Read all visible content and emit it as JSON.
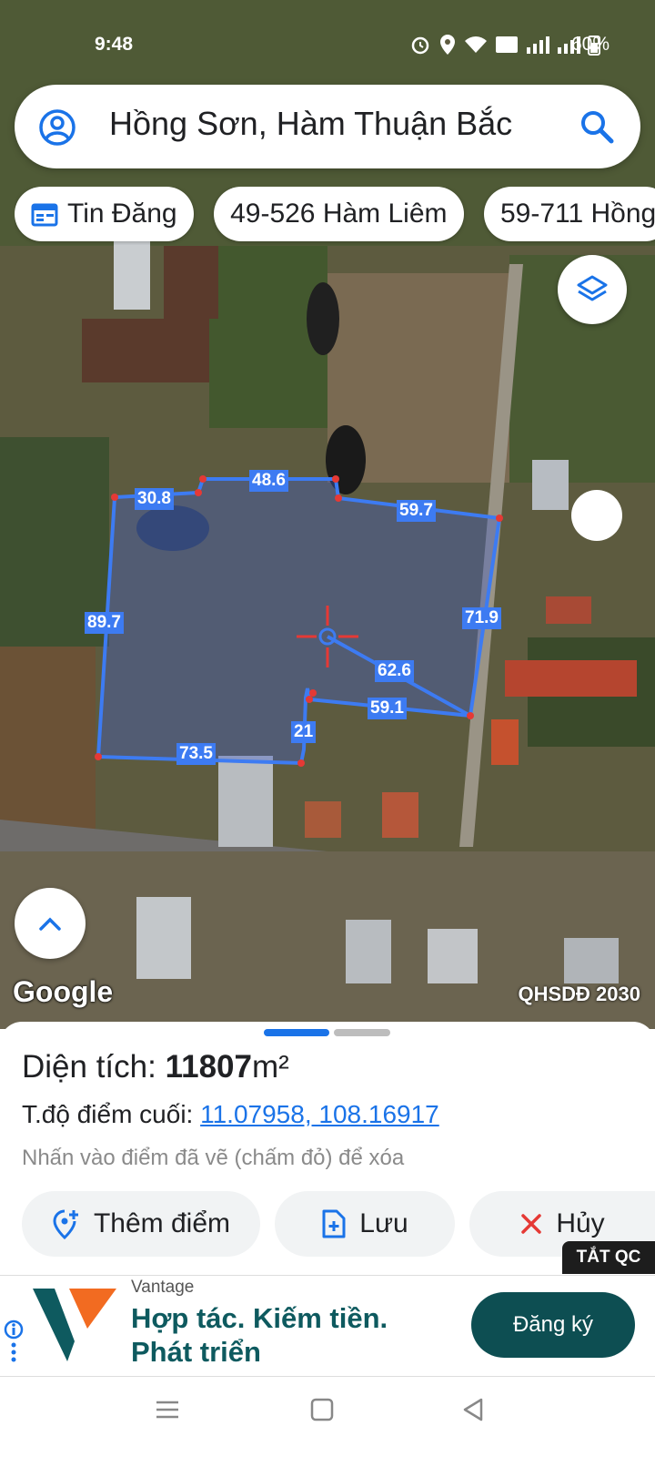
{
  "status_bar": {
    "time": "9:48",
    "battery": "60%"
  },
  "search": {
    "query": "Hồng Sơn, Hàm Thuận Bắc"
  },
  "chips": [
    {
      "label": "Tin Đăng",
      "icon": "calendar-icon"
    },
    {
      "label": "49-526 Hàm Liêm"
    },
    {
      "label": "59-711 Hồng"
    }
  ],
  "map": {
    "brand": "Google",
    "layer_name": "QHSDĐ 2030",
    "edge_labels": [
      "30.8",
      "48.6",
      "59.7",
      "71.9",
      "62.6",
      "59.1",
      "21",
      "73.5",
      "89.7"
    ],
    "polygon_color": "#3d7bf2",
    "vertex_color": "#e53935"
  },
  "sheet": {
    "area_label": "Diện tích:",
    "area_value": "11807",
    "area_unit": "m²",
    "endpoint_label": "T.độ điểm cuối:",
    "endpoint_coords": "11.07958, 108.16917",
    "hint": "Nhấn vào điểm đã vẽ (chấm đỏ) để xóa",
    "buttons": {
      "add_point": "Thêm điểm",
      "save": "Lưu",
      "cancel": "Hủy"
    }
  },
  "ad": {
    "tag": "TẮT QC",
    "brand": "Vantage",
    "headline_line1": "Hợp tác. Kiếm tiền.",
    "headline_line2": "Phát triển",
    "cta": "Đăng ký"
  }
}
